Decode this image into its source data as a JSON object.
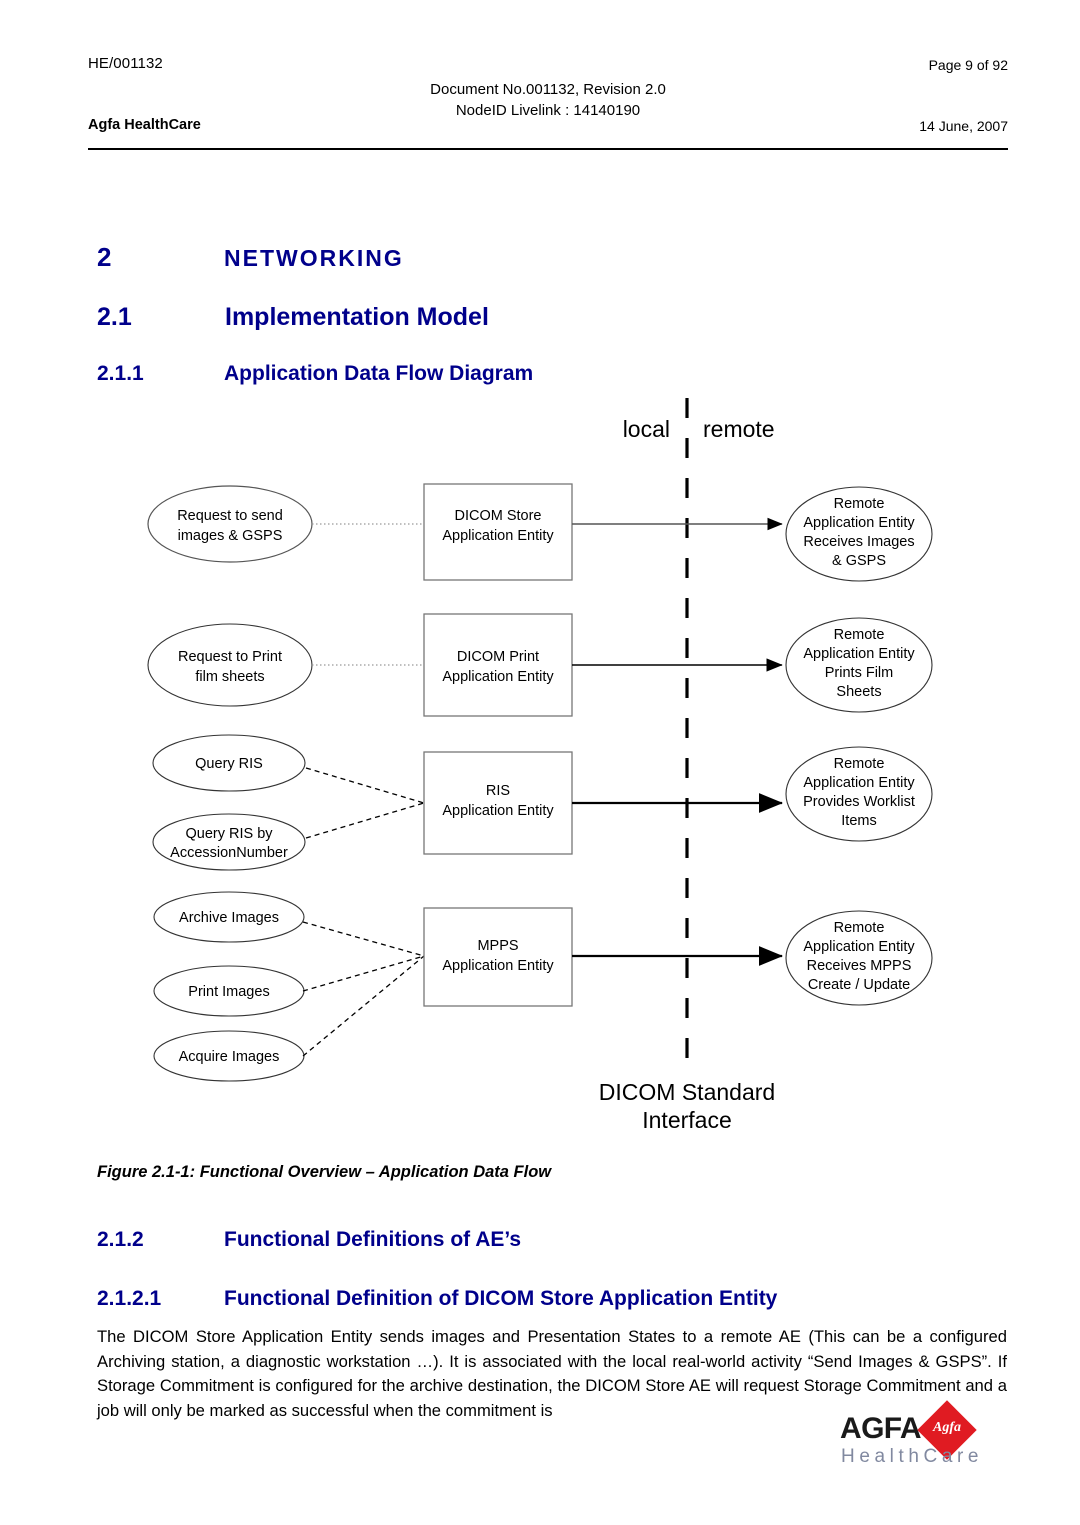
{
  "header": {
    "doc_id": "HE/001132",
    "page_info": "Page 9 of 92",
    "center_line1": "Document No.001132, Revision 2.0",
    "center_line2": "NodeID Livelink : 14140190",
    "company": "Agfa HealthCare",
    "date": "14 June, 2007"
  },
  "headings": {
    "h1_num": "2",
    "h1_text": "NETWORKING",
    "h2_num": "2.1",
    "h2_text": "Implementation Model",
    "h3_num": "2.1.1",
    "h3_text": "Application Data Flow Diagram",
    "h2b_num": "2.1.2",
    "h2b_text": "Functional Definitions of AE’s",
    "h3b_num": "2.1.2.1",
    "h3b_text": "Functional Definition of DICOM Store Application Entity"
  },
  "figure": {
    "caption": "Figure 2.1-1: Functional Overview – Application Data Flow",
    "local_label": "local",
    "remote_label": "remote",
    "boundary_label_line1": "DICOM Standard",
    "boundary_label_line2": "Interface",
    "rows": [
      {
        "source": [
          "Request to send",
          "images & GSPS"
        ],
        "entity": [
          "DICOM Store",
          "Application Entity"
        ],
        "remote": [
          "Remote",
          "Application Entity",
          "Receives Images",
          "& GSPS"
        ]
      },
      {
        "source": [
          "Request to Print",
          "film sheets"
        ],
        "entity": [
          "DICOM Print",
          "Application Entity"
        ],
        "remote": [
          "Remote",
          "Application Entity",
          "Prints Film",
          "Sheets"
        ]
      },
      {
        "source_multi": [
          [
            "Query RIS"
          ],
          [
            "Query RIS by",
            "AccessionNumber"
          ]
        ],
        "entity": [
          "RIS",
          "Application Entity"
        ],
        "remote": [
          "Remote",
          "Application Entity",
          "Provides Worklist",
          "Items"
        ]
      },
      {
        "source_multi": [
          [
            "Archive Images"
          ],
          [
            "Print Images"
          ],
          [
            "Acquire Images"
          ]
        ],
        "entity": [
          "MPPS",
          "Application Entity"
        ],
        "remote": [
          "Remote",
          "Application Entity",
          "Receives MPPS",
          "Create / Update"
        ]
      }
    ]
  },
  "body": {
    "paragraph": "The DICOM Store Application Entity sends images and Presentation States to a remote AE (This can be a configured Archiving station, a diagnostic workstation …). It is associated with the local real-world activity “Send Images & GSPS”. If Storage Commitment is configured for the archive destination, the DICOM Store AE will request Storage Commitment and a job will only be marked as successful when the commitment is"
  },
  "logo": {
    "brand": "AGFA",
    "diamond_text": "Agfa",
    "sub": "HealthCare",
    "diamond_color": "#E01B22",
    "sub_color": "#8189A0"
  },
  "colors": {
    "heading_blue": "#00008B",
    "text_black": "#000000"
  }
}
